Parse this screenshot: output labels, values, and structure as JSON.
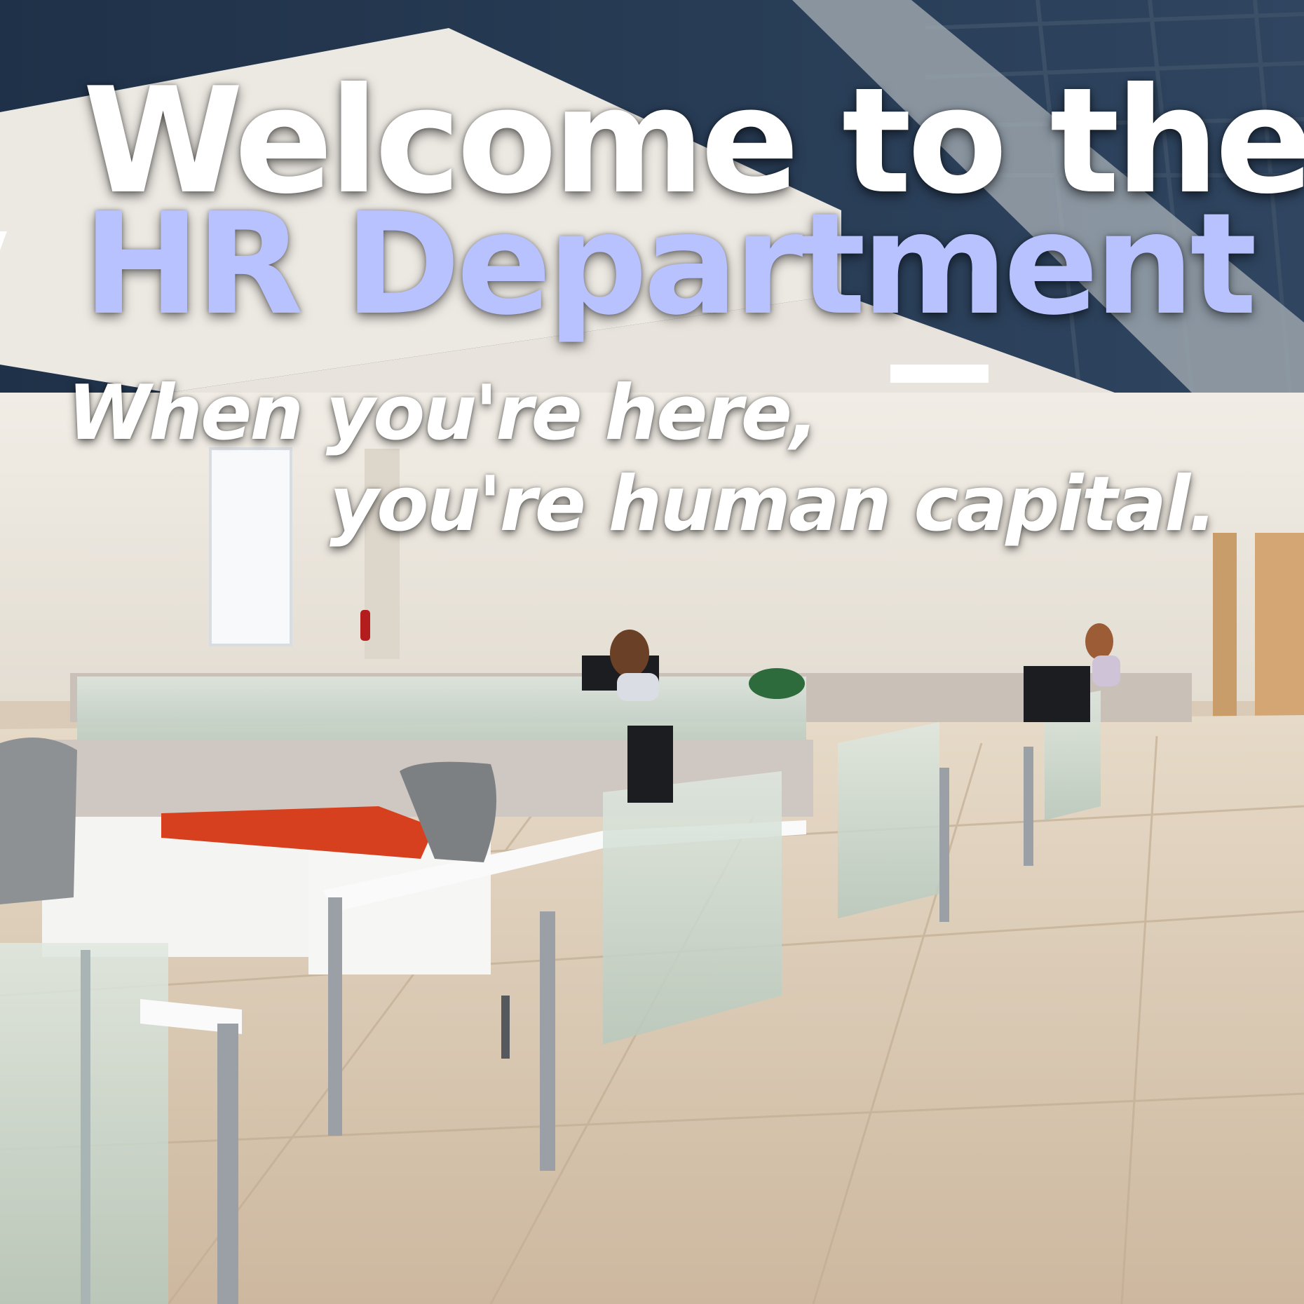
{
  "poster": {
    "headline_line1": "Welcome to the",
    "headline_line2": "HR Department",
    "tagline_line1": "When you're here,",
    "tagline_line2": "you're human capital."
  },
  "colors": {
    "headline_primary": "#ffffff",
    "headline_accent": "#b8c2ff",
    "ceiling_dark": "#283d55",
    "floor_tile": "#d8c8b3",
    "cushion_red": "#d7401f"
  }
}
